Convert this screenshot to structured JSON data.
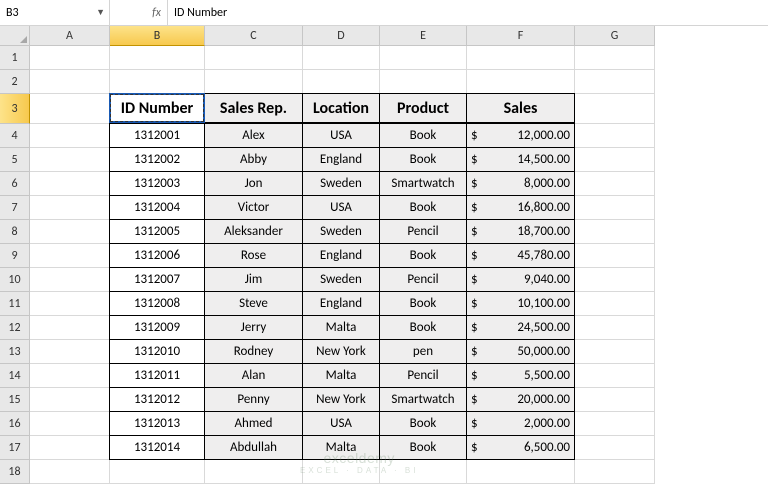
{
  "name_box": "B3",
  "fx_label": "fx",
  "formula_value": "ID Number",
  "columns": [
    "A",
    "B",
    "C",
    "D",
    "E",
    "F",
    "G"
  ],
  "selected_col": "B",
  "selected_row": 3,
  "rows": [
    1,
    2,
    3,
    4,
    5,
    6,
    7,
    8,
    9,
    10,
    11,
    12,
    13,
    14,
    15,
    16,
    17,
    18
  ],
  "headers": {
    "id": "ID Number",
    "rep": "Sales Rep.",
    "loc": "Location",
    "prod": "Product",
    "sales": "Sales"
  },
  "currency": "$",
  "data": [
    {
      "id": "1312001",
      "rep": "Alex",
      "loc": "USA",
      "prod": "Book",
      "sales": "12,000.00"
    },
    {
      "id": "1312002",
      "rep": "Abby",
      "loc": "England",
      "prod": "Book",
      "sales": "14,500.00"
    },
    {
      "id": "1312003",
      "rep": "Jon",
      "loc": "Sweden",
      "prod": "Smartwatch",
      "sales": "8,000.00"
    },
    {
      "id": "1312004",
      "rep": "Victor",
      "loc": "USA",
      "prod": "Book",
      "sales": "16,800.00"
    },
    {
      "id": "1312005",
      "rep": "Aleksander",
      "loc": "Sweden",
      "prod": "Pencil",
      "sales": "18,700.00"
    },
    {
      "id": "1312006",
      "rep": "Rose",
      "loc": "England",
      "prod": "Book",
      "sales": "45,780.00"
    },
    {
      "id": "1312007",
      "rep": "Jim",
      "loc": "Sweden",
      "prod": "Pencil",
      "sales": "9,040.00"
    },
    {
      "id": "1312008",
      "rep": "Steve",
      "loc": "England",
      "prod": "Book",
      "sales": "10,100.00"
    },
    {
      "id": "1312009",
      "rep": "Jerry",
      "loc": "Malta",
      "prod": "Book",
      "sales": "24,500.00"
    },
    {
      "id": "1312010",
      "rep": "Rodney",
      "loc": "New York",
      "prod": "pen",
      "sales": "50,000.00"
    },
    {
      "id": "1312011",
      "rep": "Alan",
      "loc": "Malta",
      "prod": "Pencil",
      "sales": "5,500.00"
    },
    {
      "id": "1312012",
      "rep": "Penny",
      "loc": "New York",
      "prod": "Smartwatch",
      "sales": "20,000.00"
    },
    {
      "id": "1312013",
      "rep": "Ahmed",
      "loc": "USA",
      "prod": "Book",
      "sales": "2,000.00"
    },
    {
      "id": "1312014",
      "rep": "Abdullah",
      "loc": "Malta",
      "prod": "Book",
      "sales": "6,500.00"
    }
  ],
  "watermark": {
    "main": "exceldemy",
    "sub": "EXCEL · DATA · BI"
  }
}
